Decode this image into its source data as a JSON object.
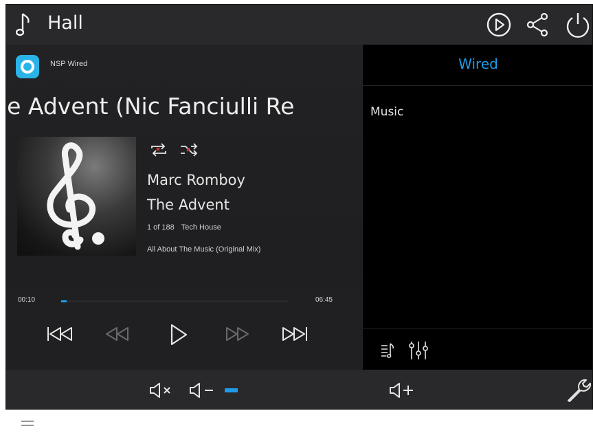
{
  "header": {
    "title": "Hall",
    "icons": [
      "music-note-icon",
      "play-circle-icon",
      "share-icon",
      "power-icon"
    ]
  },
  "source": {
    "name": "NSP Wired",
    "icon": "nsp-logo-icon"
  },
  "now_playing": {
    "track_marquee": "The Advent (Nic Fanciulli Re",
    "artist": "Marc Romboy",
    "album": "The Advent",
    "position": "1 of 188",
    "genre": "Tech House",
    "next_song": "All About The Music (Original Mix)",
    "elapsed": "00:10",
    "duration": "06:45",
    "progress_fraction": 0.025
  },
  "transport": {
    "icons": [
      "skip-previous-icon",
      "rewind-icon",
      "play-icon",
      "fast-forward-icon",
      "skip-next-icon"
    ]
  },
  "browser": {
    "title": "Wired",
    "items": [
      "Music"
    ],
    "footer_icons": [
      "queue-music-icon",
      "equalizer-icon"
    ]
  },
  "volume": {
    "level_fraction": 0.08,
    "icons": [
      "mute-icon",
      "volume-down-icon",
      "volume-up-icon",
      "wrench-icon"
    ]
  },
  "bottom": {
    "icon": "menu-icon"
  },
  "colors": {
    "accent": "#1f9be8",
    "header_bg": "#29292b",
    "panel_bg": "#202022"
  }
}
